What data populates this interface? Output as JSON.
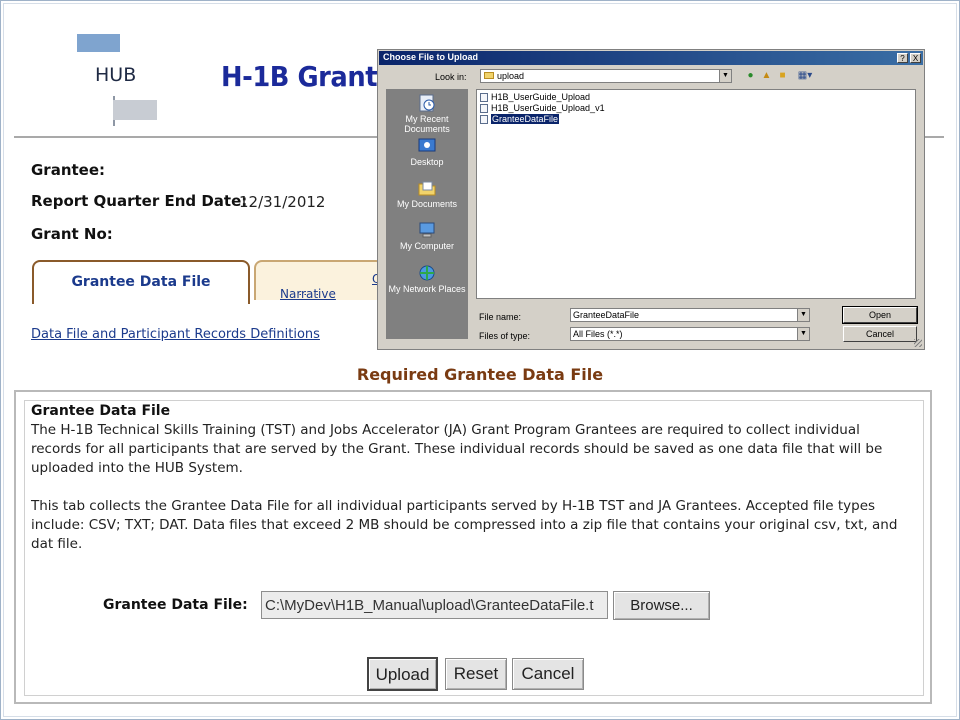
{
  "header": {
    "logo_text": "HUB",
    "title": "H-1B Grantee"
  },
  "grantee_info": {
    "grantee_label": "Grantee:",
    "report_quarter_label": "Report Quarter End Date:",
    "report_quarter_value": "12/31/2012",
    "grant_no_label": "Grant No:"
  },
  "tabs": [
    {
      "label": "Grantee Data File",
      "active": true
    },
    {
      "label_line1": "Quart",
      "label_line2": "Narrative",
      "active": false
    }
  ],
  "definitions_link": "Data File and Participant Records Definitions",
  "section_heading": "Required Grantee Data File",
  "panel": {
    "title": "Grantee Data File",
    "paragraph1": "The H-1B Technical Skills Training (TST) and Jobs Accelerator (JA) Grant Program Grantees are required to collect individual records for all participants that are served by the Grant. These individual records should be saved as one data file that will be uploaded into the HUB System.",
    "paragraph2": "This tab collects the Grantee Data File for all individual participants served by H-1B TST and JA Grantees. Accepted file types include: CSV; TXT; DAT. Data files that exceed 2 MB should be compressed into a zip file that contains your original csv, txt, and dat file.",
    "file_label": "Grantee Data File:",
    "file_path_value": "C:\\MyDev\\H1B_Manual\\upload\\GranteeDataFile.t",
    "browse_label": "Browse...",
    "upload_label": "Upload",
    "reset_label": "Reset",
    "cancel_label": "Cancel"
  },
  "dialog": {
    "title": "Choose File to Upload",
    "help": "?",
    "close": "X",
    "look_in_label": "Look in:",
    "look_in_value": "upload",
    "places": [
      {
        "label": "My Recent Documents",
        "icon": "recent-documents-icon"
      },
      {
        "label": "Desktop",
        "icon": "desktop-icon"
      },
      {
        "label": "My Documents",
        "icon": "my-documents-icon"
      },
      {
        "label": "My Computer",
        "icon": "my-computer-icon"
      },
      {
        "label": "My Network Places",
        "icon": "network-places-icon"
      }
    ],
    "files": [
      {
        "name": "H1B_UserGuide_Upload",
        "selected": false
      },
      {
        "name": "H1B_UserGuide_Upload_v1",
        "selected": false
      },
      {
        "name": "GranteeDataFile",
        "selected": true
      }
    ],
    "file_name_label": "File name:",
    "file_name_value": "GranteeDataFile",
    "files_of_type_label": "Files of type:",
    "files_of_type_value": "All Files (*.*)",
    "open_label": "Open",
    "cancel_label": "Cancel"
  },
  "colors": {
    "title_blue": "#1b2a9a",
    "tab_border": "#8a5a2a",
    "heading_brown": "#7a3b12",
    "dialog_titlebar": "#0a246a",
    "selection": "#0a246a"
  }
}
